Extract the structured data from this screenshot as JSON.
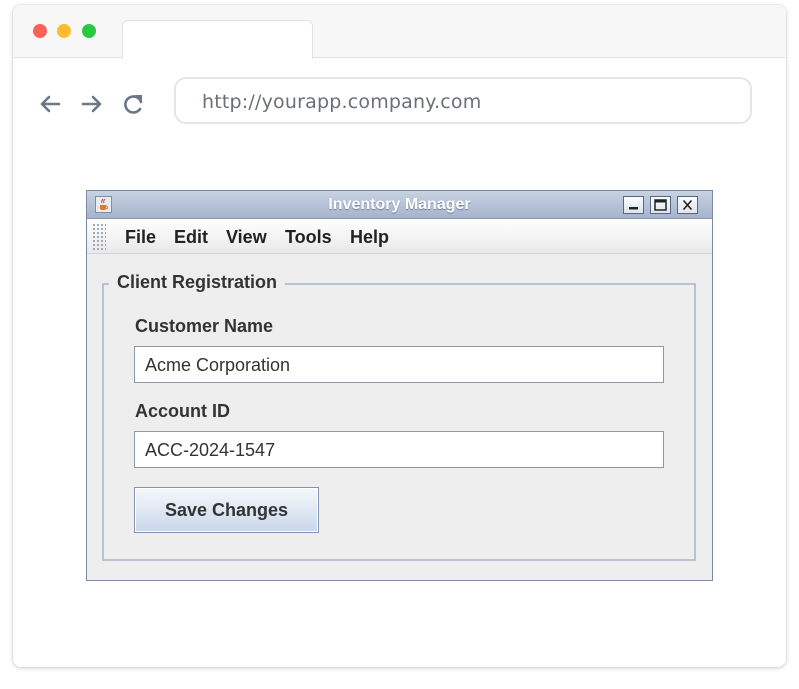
{
  "browser": {
    "url": "http://yourapp.company.com",
    "tab_title": ""
  },
  "window": {
    "title": "Inventory Manager"
  },
  "menu": {
    "items": [
      "File",
      "Edit",
      "View",
      "Tools",
      "Help"
    ]
  },
  "form": {
    "legend": "Client Registration",
    "customer_name_label": "Customer Name",
    "customer_name_value": "Acme Corporation",
    "account_id_label": "Account ID",
    "account_id_value": "ACC-2024-1547",
    "save_label": "Save Changes"
  },
  "colors": {
    "title_bar": "#a6b4cb",
    "window_bg": "#eeeeee",
    "accent_border": "#b9c2d3"
  },
  "icons": {
    "back": "arrow-left-icon",
    "forward": "arrow-right-icon",
    "reload": "reload-icon",
    "app": "java-cup-icon",
    "minimize": "minimize-icon",
    "maximize": "maximize-icon",
    "close": "close-icon"
  }
}
